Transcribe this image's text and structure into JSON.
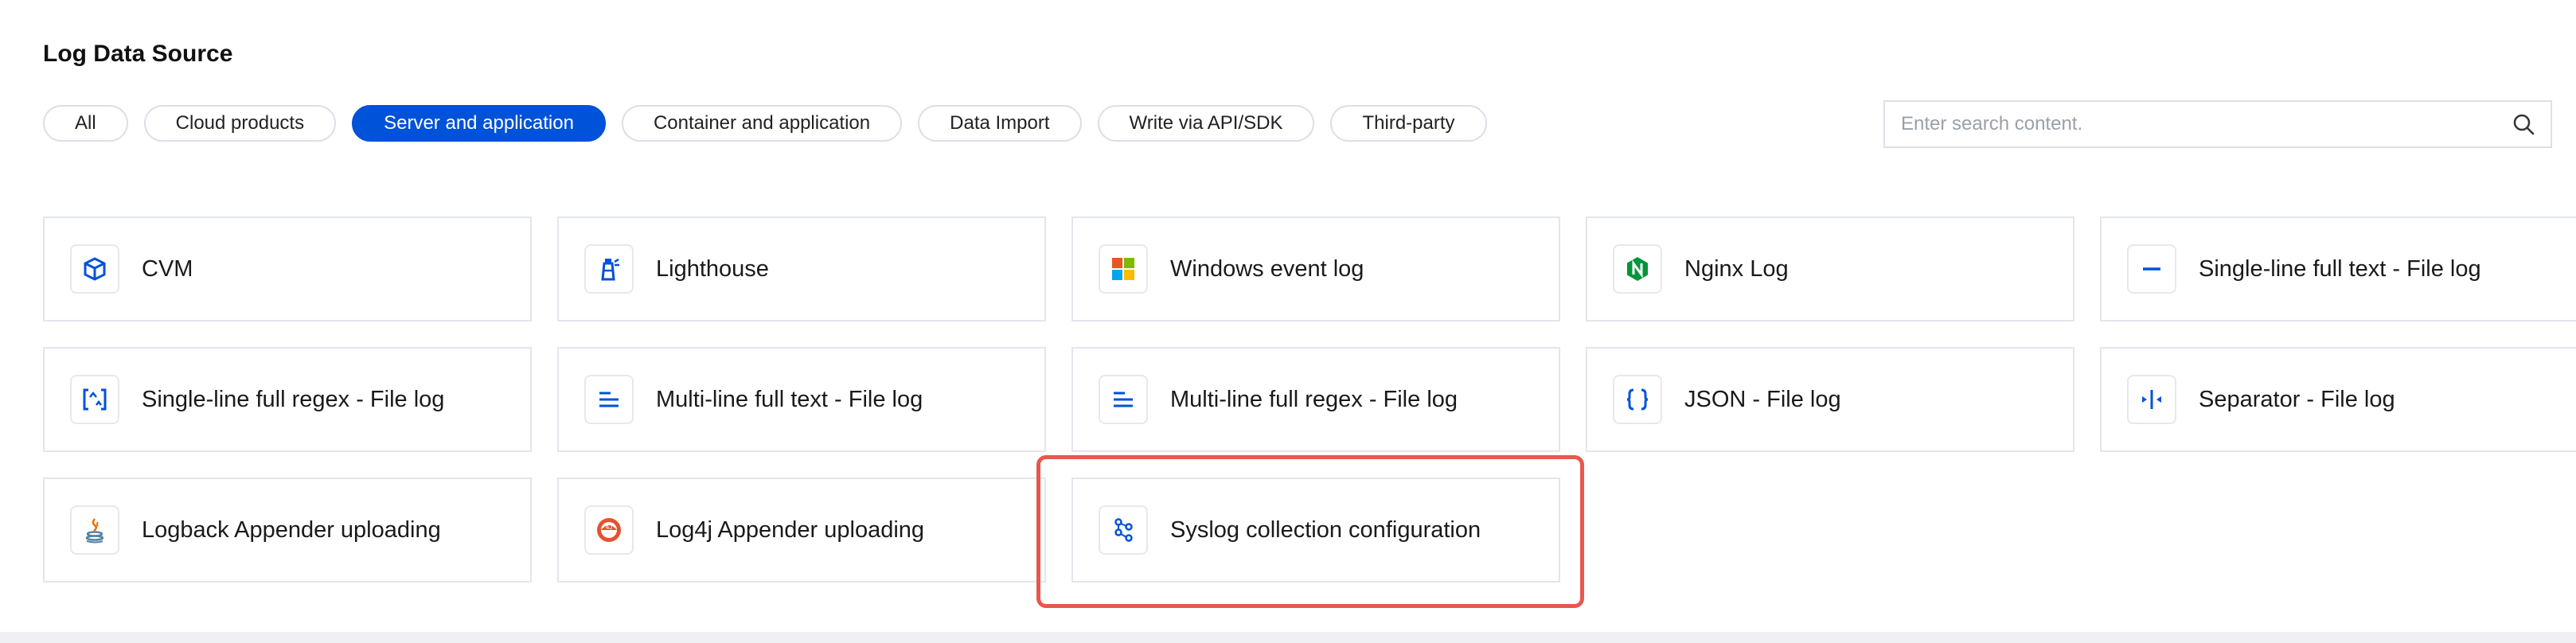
{
  "page": {
    "title": "Log Data Source"
  },
  "tabs": [
    {
      "label": "All",
      "active": false
    },
    {
      "label": "Cloud products",
      "active": false
    },
    {
      "label": "Server and application",
      "active": true
    },
    {
      "label": "Container and application",
      "active": false
    },
    {
      "label": "Data Import",
      "active": false
    },
    {
      "label": "Write via API/SDK",
      "active": false
    },
    {
      "label": "Third-party",
      "active": false
    }
  ],
  "search": {
    "placeholder": "Enter search content.",
    "icon": "search-icon"
  },
  "cards": [
    {
      "label": "CVM",
      "icon": "cvm-icon"
    },
    {
      "label": "Lighthouse",
      "icon": "lighthouse-icon"
    },
    {
      "label": "Windows event log",
      "icon": "windows-icon"
    },
    {
      "label": "Nginx Log",
      "icon": "nginx-icon"
    },
    {
      "label": "Single-line full text - File log",
      "icon": "single-line-icon"
    },
    {
      "label": "Single-line full regex - File log",
      "icon": "regex-icon"
    },
    {
      "label": "Multi-line full text - File log",
      "icon": "multi-line-icon"
    },
    {
      "label": "Multi-line full regex - File log",
      "icon": "multi-line-regex-icon"
    },
    {
      "label": "JSON - File log",
      "icon": "json-icon"
    },
    {
      "label": "Separator - File log",
      "icon": "separator-icon"
    },
    {
      "label": "Logback Appender uploading",
      "icon": "java-icon"
    },
    {
      "label": "Log4j Appender uploading",
      "icon": "log4j-icon"
    },
    {
      "label": "Syslog collection configuration",
      "icon": "syslog-icon"
    }
  ],
  "colors": {
    "accent": "#0052d9",
    "highlight": "#e8584d"
  }
}
